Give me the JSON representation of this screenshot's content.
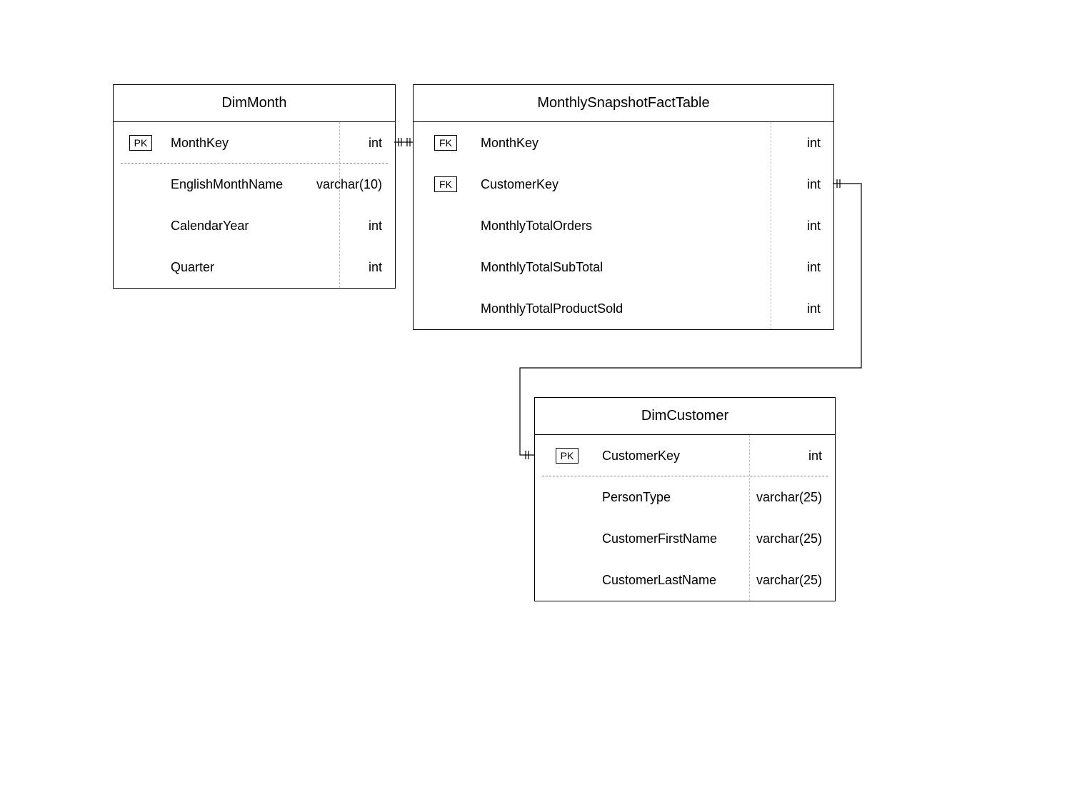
{
  "entities": {
    "dimMonth": {
      "title": "DimMonth",
      "rows": [
        {
          "key": "PK",
          "name": "MonthKey",
          "type": "int"
        },
        {
          "key": "",
          "name": "EnglishMonthName",
          "type": "varchar(10)"
        },
        {
          "key": "",
          "name": "CalendarYear",
          "type": "int"
        },
        {
          "key": "",
          "name": "Quarter",
          "type": "int"
        }
      ]
    },
    "fact": {
      "title": "MonthlySnapshotFactTable",
      "rows": [
        {
          "key": "FK",
          "name": "MonthKey",
          "type": "int"
        },
        {
          "key": "FK",
          "name": "CustomerKey",
          "type": "int"
        },
        {
          "key": "",
          "name": "MonthlyTotalOrders",
          "type": "int"
        },
        {
          "key": "",
          "name": "MonthlyTotalSubTotal",
          "type": "int"
        },
        {
          "key": "",
          "name": "MonthlyTotalProductSold",
          "type": "int"
        }
      ]
    },
    "dimCustomer": {
      "title": "DimCustomer",
      "rows": [
        {
          "key": "PK",
          "name": "CustomerKey",
          "type": "int"
        },
        {
          "key": "",
          "name": "PersonType",
          "type": "varchar(25)"
        },
        {
          "key": "",
          "name": "CustomerFirstName",
          "type": "varchar(25)"
        },
        {
          "key": "",
          "name": "CustomerLastName",
          "type": "varchar(25)"
        }
      ]
    }
  }
}
